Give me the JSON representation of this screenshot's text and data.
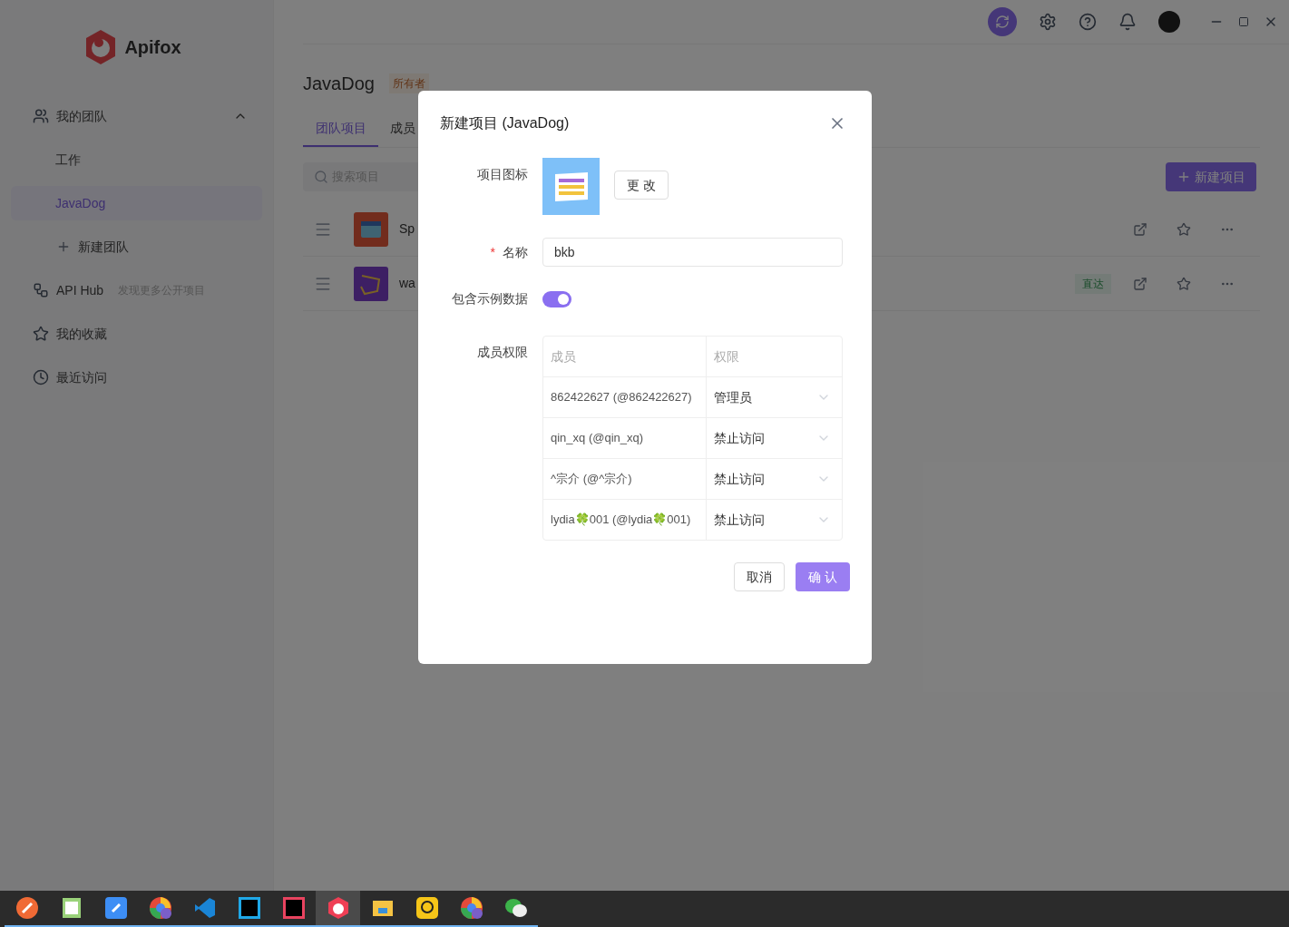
{
  "app": {
    "name": "Apifox"
  },
  "sidebar": {
    "items": [
      {
        "kind": "group",
        "label": "我的团队",
        "expanded": true,
        "children": [
          {
            "kind": "team",
            "label": "工作",
            "selected": false
          },
          {
            "kind": "team",
            "label": "JavaDog",
            "selected": true
          },
          {
            "kind": "add",
            "label": "新建团队"
          }
        ]
      },
      {
        "kind": "link",
        "label": "API Hub",
        "hint": "发现更多公开项目"
      },
      {
        "kind": "link",
        "label": "我的收藏"
      },
      {
        "kind": "link",
        "label": "最近访问"
      }
    ]
  },
  "team": {
    "name": "JavaDog",
    "role": "所有者"
  },
  "tabs": [
    {
      "label": "团队项目",
      "selected": true
    },
    {
      "label": "成员",
      "selected": false
    }
  ],
  "search": {
    "placeholder": "搜索项目"
  },
  "new_project_button": "新建项目",
  "projects": [
    {
      "name": "Sp"
    },
    {
      "name": "wa",
      "tag": "直达"
    }
  ],
  "dialog": {
    "title": "新建项目 (JavaDog)",
    "icon_label": "项目图标",
    "change_button": "更 改",
    "name_label": "名称",
    "required_mark": "*",
    "name_value": "bkb",
    "sample_label": "包含示例数据",
    "sample_on": true,
    "permissions_label": "成员权限",
    "columns": [
      "成员",
      "权限"
    ],
    "rows": [
      {
        "member": "862422627 (@862422627)",
        "role": "管理员"
      },
      {
        "member": "qin_xq (@qin_xq)",
        "role": "禁止访问"
      },
      {
        "member": "^宗介 (@^宗介)",
        "role": "禁止访问"
      },
      {
        "member": "lydia🍀001 (@lydia🍀001)",
        "role": "禁止访问"
      }
    ],
    "cancel": "取消",
    "confirm": "确 认"
  },
  "taskbar": {
    "apps": [
      {
        "selected": false
      },
      {
        "selected": false
      },
      {
        "selected": false
      },
      {
        "selected": false
      },
      {
        "selected": false
      },
      {
        "selected": false
      },
      {
        "selected": false
      },
      {
        "selected": true
      },
      {
        "selected": false
      },
      {
        "selected": false
      },
      {
        "selected": false
      },
      {
        "selected": false
      }
    ]
  }
}
